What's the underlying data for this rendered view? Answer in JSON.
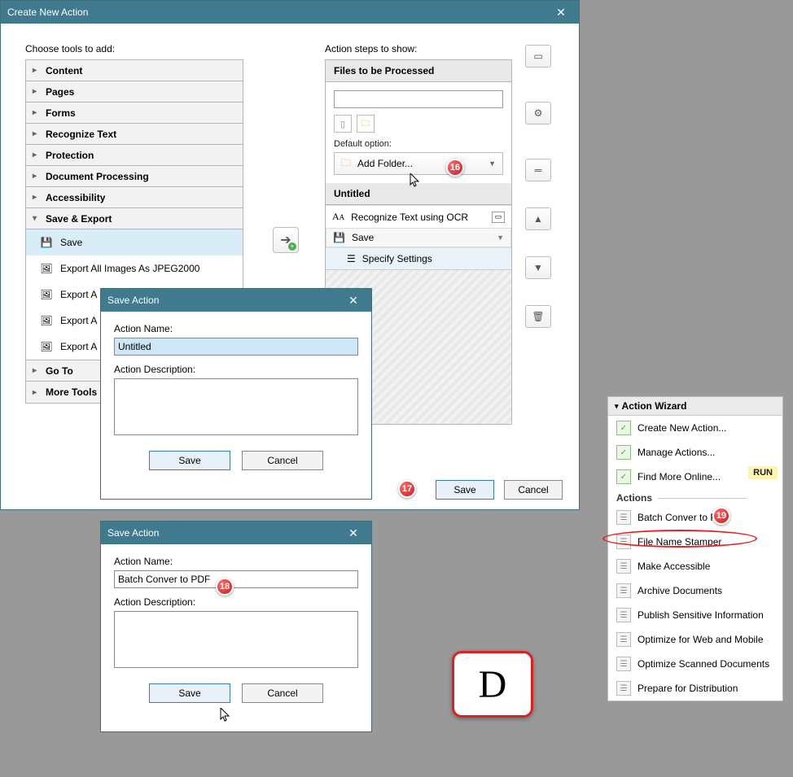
{
  "main_dialog": {
    "title": "Create New Action",
    "choose_label": "Choose tools to add:",
    "steps_label": "Action steps to show:",
    "tools": {
      "content": "Content",
      "pages": "Pages",
      "forms": "Forms",
      "recognize": "Recognize Text",
      "protection": "Protection",
      "docproc": "Document Processing",
      "accessibility": "Accessibility",
      "saveexport": "Save & Export",
      "goto": "Go To",
      "moretools": "More Tools"
    },
    "save_items": {
      "save": "Save",
      "jpeg2000": "Export All Images As JPEG2000",
      "exporta1": "Export A",
      "exporta2": "Export A",
      "exporta3": "Export A"
    },
    "steps": {
      "files_header": "Files to be Processed",
      "default_option": "Default option:",
      "add_folder": "Add Folder...",
      "untitled_header": "Untitled",
      "recognize_ocr": "Recognize Text using OCR",
      "save_step": "Save",
      "specify": "Specify Settings"
    },
    "save_btn": "Save",
    "cancel_btn": "Cancel"
  },
  "save_dialog": {
    "title": "Save Action",
    "name_label": "Action Name:",
    "desc_label": "Action Description:",
    "untitled": "Untitled",
    "batch": "Batch Conver to PDF",
    "save_btn": "Save",
    "cancel_btn": "Cancel"
  },
  "wizard": {
    "title": "Action Wizard",
    "create": "Create New Action...",
    "manage": "Manage Actions...",
    "find": "Find More Online...",
    "run_tag": "RUN",
    "actions_label": "Actions",
    "items": {
      "batch": "Batch Conver to PDF",
      "stamper": "File Name Stamper",
      "accessible": "Make Accessible",
      "archive": "Archive Documents",
      "publish": "Publish Sensitive Information",
      "optimize_web": "Optimize for Web and Mobile",
      "optimize_scan": "Optimize Scanned Documents",
      "prepare": "Prepare for Distribution"
    }
  },
  "badges": {
    "b16": "16",
    "b17": "17",
    "b18": "18",
    "b19": "19"
  },
  "big_d": "D"
}
